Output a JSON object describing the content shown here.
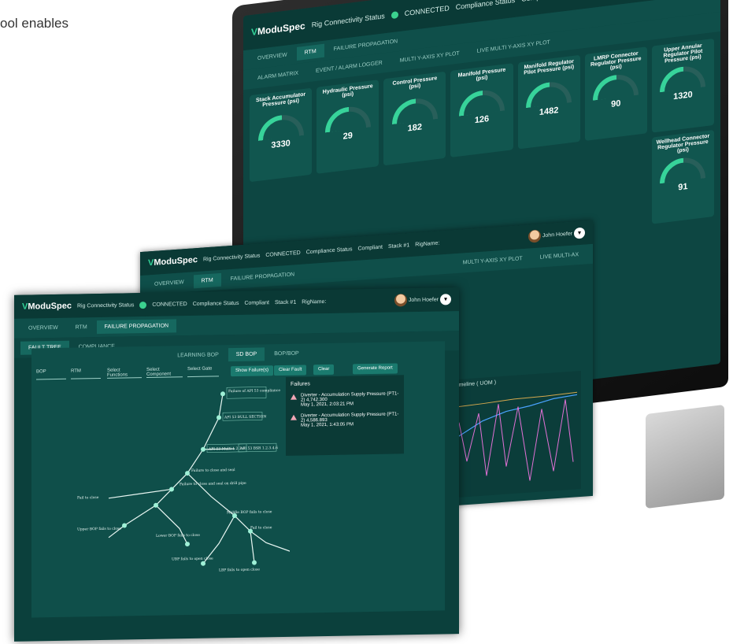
{
  "caption": "ool enables",
  "brand": {
    "logo_mark": "V",
    "name": "ModuSpec",
    "accent": "#37d39a",
    "bg": "#0d4642"
  },
  "user": {
    "name": "John Hoefer"
  },
  "status_bar": {
    "connectivity_label": "Rig Connectivity Status",
    "connected": "CONNECTED",
    "compliance_label": "Compliance Status",
    "compliant": "Compliant",
    "stack_label": "Stack #1",
    "rig_label": "RigName:"
  },
  "monitor": {
    "tabs_row1": [
      "OVERVIEW",
      "RTM",
      "FAILURE PROPAGATION"
    ],
    "tabs_row2": [
      "ALARM MATRIX",
      "EVENT / ALARM LOGGER",
      "MULTI Y-AXIS XY PLOT",
      "LIVE MULTI Y-AXIS XY PLOT"
    ],
    "gauges": [
      {
        "title": "Stack Accumulator Pressure (psi)",
        "value": "3330"
      },
      {
        "title": "Hydraulic Pressure (psi)",
        "value": "29"
      },
      {
        "title": "Control Pressure (psi)",
        "value": "182"
      },
      {
        "title": "Manifold Pressure (psi)",
        "value": "126"
      },
      {
        "title": "Manifold Regulator Pilot Pressure (psi)",
        "value": "1482"
      },
      {
        "title": "LMRP Connector Regulator Pressure (psi)",
        "value": "90"
      },
      {
        "title": "Upper Annular Regulator Pilot Pressure (psi)",
        "value": "1320"
      }
    ],
    "lower_gauge": {
      "title": "Wellhead Connector Regulator Pressure (psi)",
      "value": "91"
    }
  },
  "win2": {
    "tabs": [
      "OVERVIEW",
      "RTM",
      "FAILURE PROPAGATION"
    ],
    "plot_tabs": [
      "MULTI Y-AXIS XY PLOT",
      "LIVE MULTI-AX"
    ],
    "chart_title": "Timeline ( UOM )"
  },
  "win3": {
    "tabs": [
      "OVERVIEW",
      "RTM",
      "FAILURE PROPAGATION"
    ],
    "subtabs": [
      "FAULT TREE",
      "COMPLIANCE"
    ],
    "views": [
      "LEARNING BOP",
      "SD BOP",
      "BOP/BOP"
    ],
    "selects": [
      "BOP",
      "RTM",
      "Select Functions",
      "Select Component",
      "Select Gate"
    ],
    "buttons": [
      "Show Failure(s)",
      "Clear Fault",
      "Clear",
      "Generate Report"
    ],
    "failures": {
      "title": "Failures",
      "items": [
        {
          "text": "Diverter - Accumulation Supply Pressure (PT1-2) 4,742.300",
          "date": "May 1, 2021, 2:03:21 PM"
        },
        {
          "text": "Diverter - Accumulation Supply Pressure (PT1-2) 4,586.893",
          "date": "May 1, 2021, 1:43:05 PM"
        }
      ]
    },
    "tree_labels": [
      "Failure of API 53 compliance",
      "API 53 BULL SECTION",
      "API 53 Multi-1.2.3.6",
      "Failure to close and seal",
      "API 53 BSR 1.2.3.4.6",
      "Failure to close and seal on drill pipe",
      "Fail to close",
      "Upper BOP fails to close",
      "Lower BOP fails to close",
      "Middle BOP fails to close",
      "Middle BOP",
      "Fail to close",
      "UBP fails to open close",
      "LBP fails to open close",
      "UBP fails to open close"
    ]
  }
}
